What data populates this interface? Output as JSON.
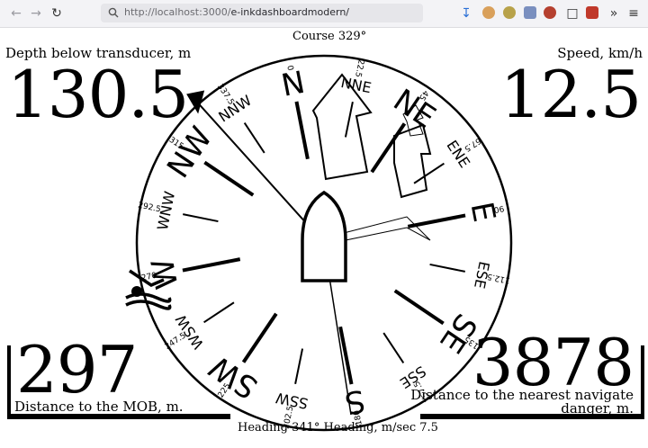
{
  "browser": {
    "url_host": "http://localhost:3000/",
    "url_path": "e-inkdashboardmodern/"
  },
  "depth": {
    "label": "Depth below transducer, m",
    "value": "130.5"
  },
  "speed": {
    "label": "Speed, km/h",
    "value": "12.5"
  },
  "mob": {
    "label": "Distance to the MOB, m.",
    "value": "297"
  },
  "danger": {
    "label_line1": "Distance to the nearest navigate",
    "label_line2": "danger, m.",
    "value": "3878"
  },
  "course": {
    "label": "Course 329°",
    "value_deg": 329
  },
  "footer": {
    "text": "Heading 341° Heading, m/sec 7.5"
  },
  "compass": {
    "rotation_deg": -11,
    "points": [
      {
        "text": "N",
        "deg": 0,
        "major": true
      },
      {
        "text": "NNE",
        "deg": 22.5,
        "major": false
      },
      {
        "text": "NE",
        "deg": 45,
        "major": true
      },
      {
        "text": "ENE",
        "deg": 67.5,
        "major": false
      },
      {
        "text": "E",
        "deg": 90,
        "major": true
      },
      {
        "text": "ESE",
        "deg": 112.5,
        "major": false
      },
      {
        "text": "SE",
        "deg": 135,
        "major": true
      },
      {
        "text": "SSE",
        "deg": 157.5,
        "major": false
      },
      {
        "text": "S",
        "deg": 180,
        "major": true
      },
      {
        "text": "SSW",
        "deg": 202.5,
        "major": false
      },
      {
        "text": "SW",
        "deg": 225,
        "major": true
      },
      {
        "text": "WSW",
        "deg": 247.5,
        "major": false
      },
      {
        "text": "W",
        "deg": 270,
        "major": true
      },
      {
        "text": "WNW",
        "deg": 292.5,
        "major": false
      },
      {
        "text": "NW",
        "deg": 315,
        "major": true
      },
      {
        "text": "NNW",
        "deg": 337.5,
        "major": false
      }
    ],
    "degree_labels": [
      "0",
      "22.5",
      "45",
      "67.5",
      "90",
      "112.5",
      "135",
      "157.5",
      "180",
      "202.5",
      "225",
      "247.5",
      "270",
      "292.5",
      "315",
      "337.5"
    ]
  }
}
